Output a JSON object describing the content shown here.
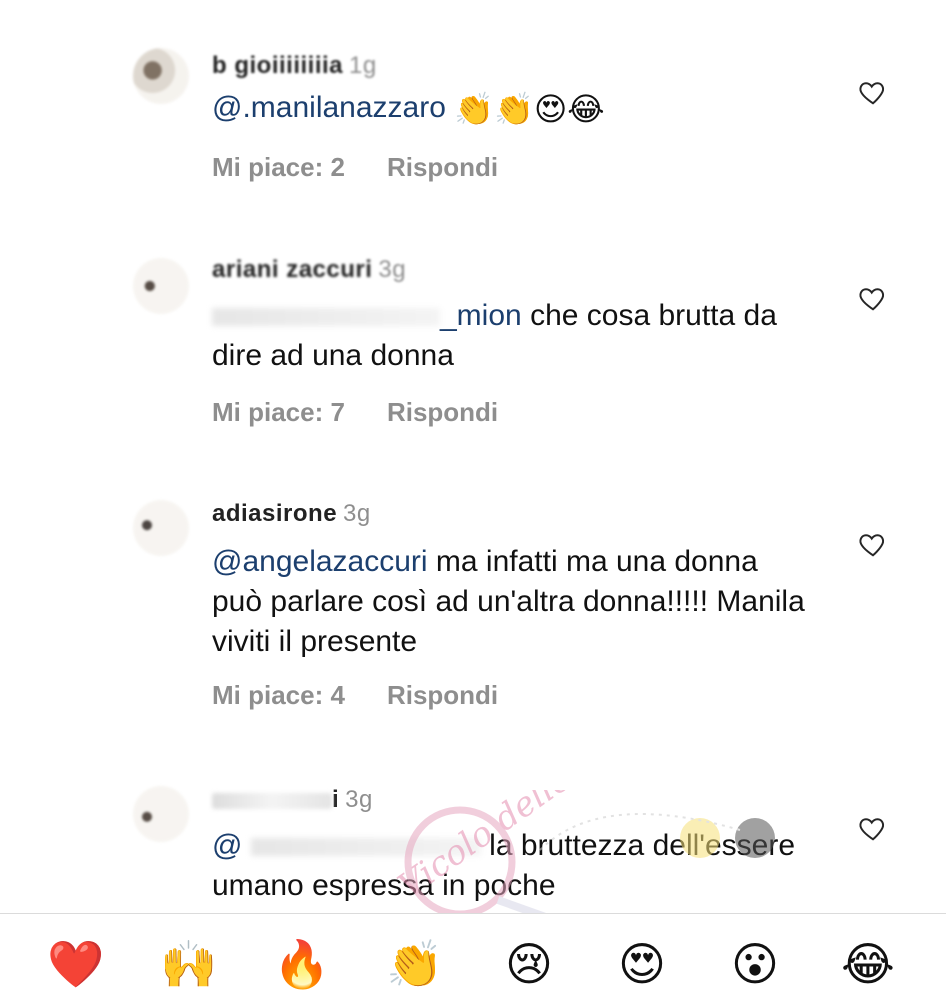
{
  "comments": [
    {
      "username": "b  gioiiiiiiiia",
      "time": "1g",
      "mention": "@.manilanazzaro",
      "text": "",
      "emojis": [
        "👏",
        "👏",
        "😍",
        "😂"
      ],
      "likes_label": "Mi piace: 2",
      "reply_label": "Rispondi"
    },
    {
      "username": "ariani    zaccuri",
      "time": "3g",
      "mention": "_mion",
      "text": "che cosa brutta da dire ad una donna",
      "likes_label": "Mi piace: 7",
      "reply_label": "Rispondi"
    },
    {
      "username": "adiasirone",
      "time": "3g",
      "mention": "@angelazaccuri",
      "text": "ma infatti ma una donna può  parlare così ad un'altra donna!!!!! Manila viviti il presente",
      "likes_label": "Mi piace: 4",
      "reply_label": "Rispondi"
    },
    {
      "username": "i",
      "time": "3g",
      "mention": "@",
      "text": "la bruttezza dell'essere umano espressa in poche",
      "likes_label": "",
      "reply_label": ""
    }
  ],
  "watermark": {
    "text": "Vicolo delle News"
  },
  "reactions": [
    "❤️",
    "🙌",
    "🔥",
    "👏",
    "😢",
    "😍",
    "😮",
    "😂"
  ],
  "colors": {
    "mention": "#1c3f6e",
    "meta": "#8e8e8e",
    "heart_outline": "#262626"
  }
}
